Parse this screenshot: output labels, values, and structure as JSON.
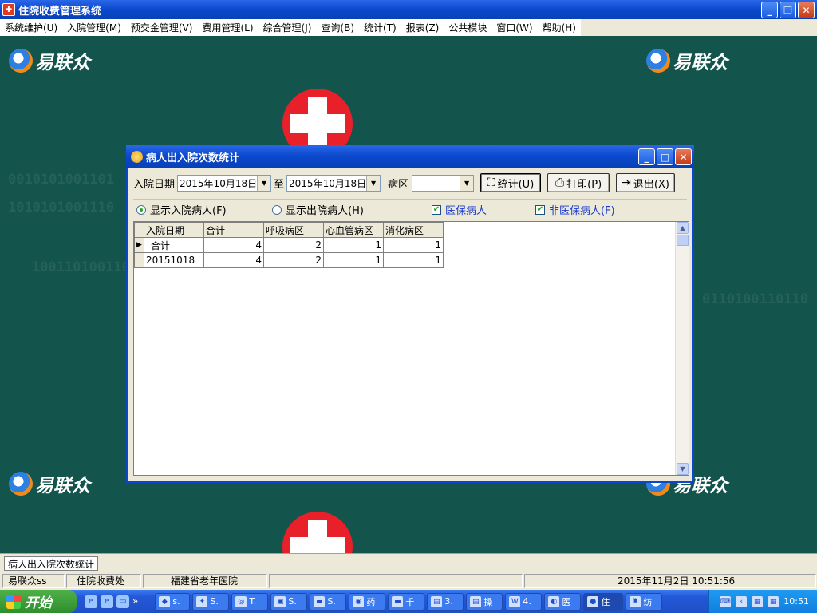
{
  "window": {
    "title": "住院收费管理系统",
    "min": "_",
    "max": "❐",
    "close": "✕"
  },
  "menu": [
    "系统维护(U)",
    "入院管理(M)",
    "预交金管理(V)",
    "费用管理(L)",
    "综合管理(J)",
    "查询(B)",
    "统计(T)",
    "报表(Z)",
    "公共模块",
    "窗口(W)",
    "帮助(H)"
  ],
  "background": {
    "logo_text": "易联众",
    "binary_1": "0010101001101",
    "binary_2": "1010101001110",
    "binary_3": "1001101001101",
    "binary_4": "0110100110110"
  },
  "dialog": {
    "title": "病人出入院次数统计",
    "min": "_",
    "max": "□",
    "close": "✕",
    "date_label": "入院日期",
    "date_from": "2015年10月18日",
    "to_label": "至",
    "date_to": "2015年10月18日",
    "ward_label": "病区",
    "ward_value": "",
    "btn_stat": "统计(U)",
    "btn_print": "打印(P)",
    "btn_exit": "退出(X)",
    "radio_in": "显示入院病人(F)",
    "radio_out": "显示出院病人(H)",
    "chk_insured": "医保病人",
    "chk_uninsured": "非医保病人(F)",
    "check_mark": "✔",
    "row_pointer": "▶",
    "columns": [
      "入院日期",
      "合计",
      "呼吸病区",
      "心血管病区",
      "消化病区"
    ],
    "rows": [
      [
        "合计",
        "4",
        "2",
        "1",
        "1"
      ],
      [
        "20151018",
        "4",
        "2",
        "1",
        "1"
      ]
    ]
  },
  "mdi_tab": "病人出入院次数统计",
  "status": {
    "user": "易联众ss",
    "dept": "住院收费处",
    "hospital": "福建省老年医院",
    "datetime": "2015年11月2日  10:51:56"
  },
  "taskbar": {
    "start": "开始",
    "more": "»",
    "tasks": [
      "s.",
      "S.",
      "T.",
      "S.",
      "S.",
      "药",
      "千",
      "3.",
      "操",
      "4.",
      "医",
      "住",
      "纺"
    ],
    "clock": "10:51"
  },
  "colors": {
    "desktop": "#13554d",
    "titlebar": "#0a48cc",
    "accent_blue": "#1a3ad0"
  }
}
